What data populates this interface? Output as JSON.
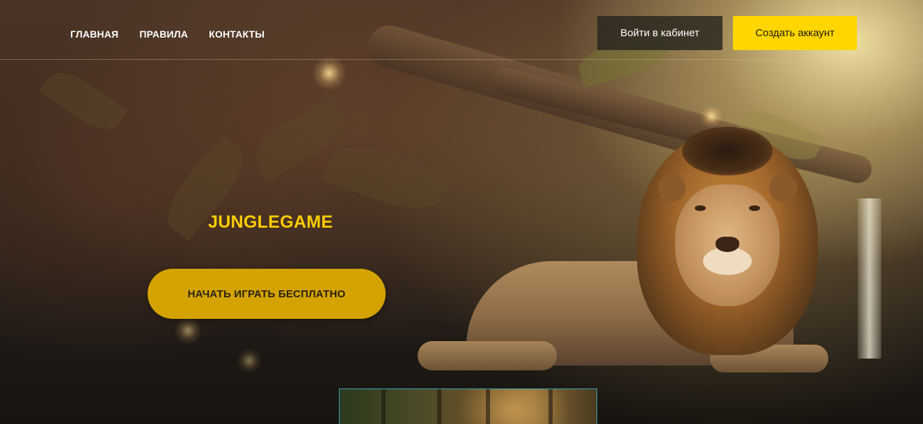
{
  "nav": {
    "links": [
      "ГЛАВНАЯ",
      "ПРАВИЛА",
      "КОНТАКТЫ"
    ],
    "login_label": "Войти в кабинет",
    "register_label": "Создать аккаунт"
  },
  "hero": {
    "title": "JUNGLEGAME",
    "play_label": "НАЧАТЬ ИГРАТЬ БЕСПЛАТНО"
  },
  "colors": {
    "accent_yellow": "#ffd600",
    "play_button": "#d4a300",
    "title_yellow": "#ffcc00",
    "thumbnail_border": "#3aa3b8"
  }
}
